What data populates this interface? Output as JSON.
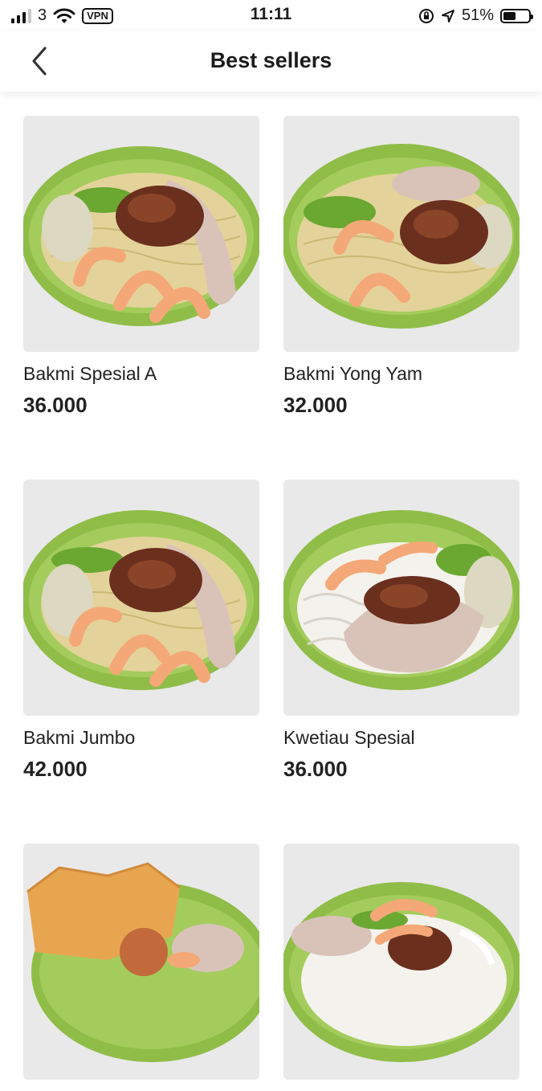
{
  "status_bar": {
    "carrier": "3",
    "vpn_label": "VPN",
    "time": "11:11",
    "battery_percent": "51%",
    "battery_level": 0.51,
    "icons": [
      "signal-icon",
      "wifi-icon",
      "vpn-icon",
      "orientation-lock-icon",
      "location-icon",
      "battery-icon"
    ]
  },
  "header": {
    "title": "Best sellers",
    "back_icon": "chevron-left-icon"
  },
  "products": [
    {
      "name": "Bakmi Spesial A",
      "price": "36.000"
    },
    {
      "name": "Bakmi Yong Yam",
      "price": "32.000"
    },
    {
      "name": "Bakmi Jumbo",
      "price": "42.000"
    },
    {
      "name": "Kwetiau Spesial",
      "price": "36.000"
    },
    {
      "name": "",
      "price": ""
    },
    {
      "name": "",
      "price": ""
    }
  ],
  "colors": {
    "bowl_green": "#8fbd48",
    "bowl_dark": "#6f9e31",
    "noodle": "#e3d39a",
    "shrimp": "#f4a877",
    "meat": "#6b2f1e",
    "meatball": "#d9c3b9",
    "scallion": "#6aa832"
  }
}
